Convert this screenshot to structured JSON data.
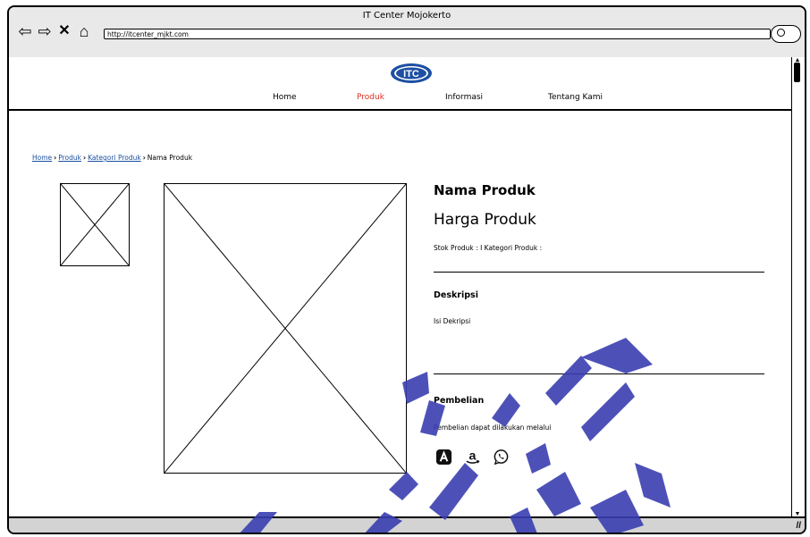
{
  "browser": {
    "title": "IT Center Mojokerto",
    "url": "http://itcenter_mjkt.com"
  },
  "site": {
    "logo_text": "aITC",
    "menu": [
      {
        "label": "Home"
      },
      {
        "label": "Produk"
      },
      {
        "label": "Informasi"
      },
      {
        "label": "Tentang Kami"
      }
    ]
  },
  "breadcrumb": {
    "home": "Home",
    "produk": "Produk",
    "kategori": "Kategori Produk",
    "current": "Nama Produk"
  },
  "product": {
    "name": "Nama Produk",
    "price": "Harga Produk",
    "meta": "Stok Produk : I Kategori Produk :",
    "description_heading": "Deskripsi",
    "description": "Isi Dekripsi",
    "purchase_heading": "Pembelian",
    "purchase_text": "Pembelian dapat dilakukan melalui"
  },
  "shops": [
    {
      "icon": "a-store-icon"
    },
    {
      "icon": "amazon-icon"
    },
    {
      "icon": "whatsapp-icon"
    }
  ],
  "colors": {
    "active_menu": "#d93025",
    "link": "#1a4fa0",
    "watermark": "#3a3fb0"
  }
}
